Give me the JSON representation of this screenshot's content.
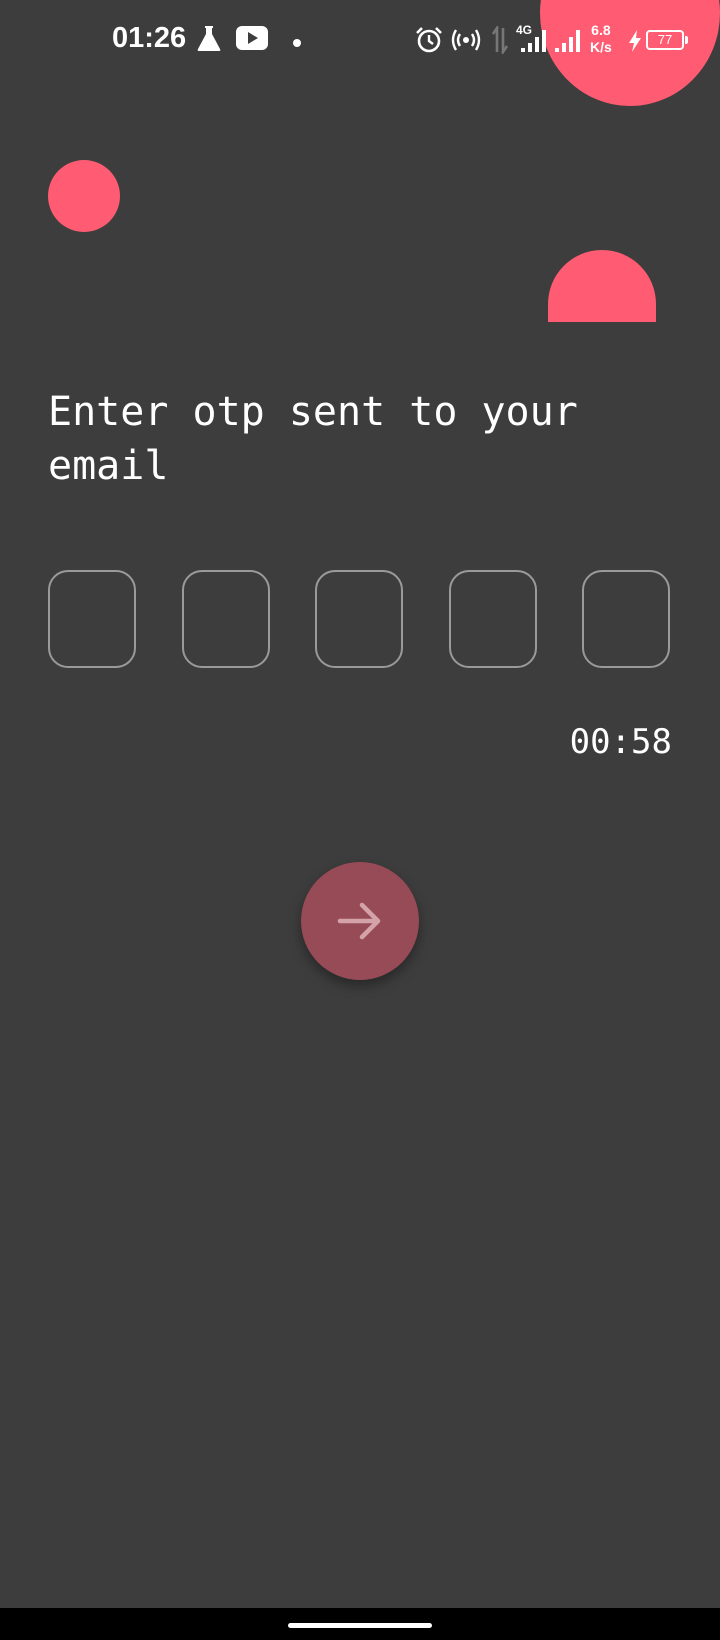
{
  "status_bar": {
    "time": "01:26",
    "network_speed_value": "6.8",
    "network_speed_unit": "K/s",
    "network_type": "4G",
    "battery_level": "77",
    "icons": [
      "flask-icon",
      "youtube-icon",
      "dot-icon",
      "alarm-icon",
      "hotspot-icon",
      "data-transfer-icon",
      "signal-icon",
      "signal-icon",
      "charging-bolt-icon",
      "battery-icon"
    ]
  },
  "page": {
    "title": "Enter otp sent to your email",
    "otp_length": 5,
    "otp_values": [
      "",
      "",
      "",
      "",
      ""
    ],
    "timer": "00:58",
    "submit_icon": "arrow-right-icon"
  },
  "colors": {
    "background": "#3d3d3d",
    "accent": "#ff5c73",
    "fab": "#974b56",
    "otp_border": "#9a9a9a",
    "text": "#ffffff"
  }
}
